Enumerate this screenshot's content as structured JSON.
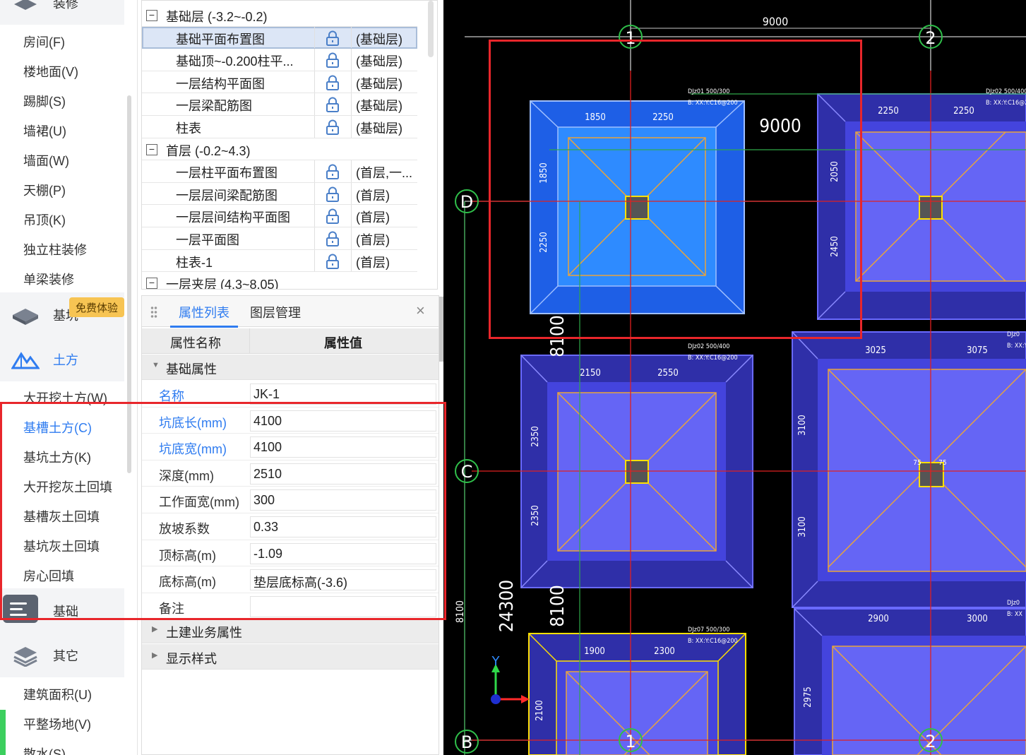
{
  "left_nav": {
    "top_partial": "装修",
    "items_a": [
      "房间(F)",
      "楼地面(V)",
      "踢脚(S)",
      "墙裙(U)",
      "墙面(W)",
      "天棚(P)",
      "吊顶(K)",
      "独立柱装修",
      "单梁装修"
    ],
    "cat_foundation_partial": "基坑",
    "free_badge": "免费体验",
    "cat_earthwork": "土方",
    "items_b": [
      "大开挖土方(W)",
      "基槽土方(C)",
      "基坑土方(K)",
      "大开挖灰土回填",
      "基槽灰土回填",
      "基坑灰土回填",
      "房心回填"
    ],
    "cat_base": "基础",
    "cat_other": "其它",
    "items_c": [
      "建筑面积(U)",
      "平整场地(V)",
      "散水(S)"
    ]
  },
  "tree": {
    "groups": [
      {
        "label": "基础层 (-3.2~-0.2)",
        "rows": [
          {
            "name": "基础平面布置图",
            "layer": "(基础层)"
          },
          {
            "name": "基础顶~-0.200柱平...",
            "layer": "(基础层)"
          },
          {
            "name": "一层结构平面图",
            "layer": "(基础层)"
          },
          {
            "name": "一层梁配筋图",
            "layer": "(基础层)"
          },
          {
            "name": "柱表",
            "layer": "(基础层)"
          }
        ]
      },
      {
        "label": "首层 (-0.2~4.3)",
        "rows": [
          {
            "name": "一层柱平面布置图",
            "layer": "(首层,一..."
          },
          {
            "name": "一层层间梁配筋图",
            "layer": "(首层)"
          },
          {
            "name": "一层层间结构平面图",
            "layer": "(首层)"
          },
          {
            "name": "一层平面图",
            "layer": "(首层)"
          },
          {
            "name": "柱表-1",
            "layer": "(首层)"
          }
        ]
      },
      {
        "label": "一层夹层 (4.3~8.05)",
        "rows": []
      }
    ],
    "expand_symbol": "−"
  },
  "props": {
    "tab_active": "属性列表",
    "tab_other": "图层管理",
    "col_name": "属性名称",
    "col_value": "属性值",
    "section_base": "基础属性",
    "rows": [
      {
        "k": "名称",
        "v": "JK-1",
        "blue": true
      },
      {
        "k": "坑底长(mm)",
        "v": "4100",
        "blue": true
      },
      {
        "k": "坑底宽(mm)",
        "v": "4100",
        "blue": true
      },
      {
        "k": "深度(mm)",
        "v": "2510",
        "blue": false
      },
      {
        "k": "工作面宽(mm)",
        "v": "300",
        "blue": false
      },
      {
        "k": "放坡系数",
        "v": "0.33",
        "blue": false
      },
      {
        "k": "顶标高(m)",
        "v": "-1.09",
        "blue": false
      },
      {
        "k": "底标高(m)",
        "v": "垫层底标高(-3.6)",
        "blue": false
      },
      {
        "k": "备注",
        "v": "",
        "blue": false
      }
    ],
    "section_civil": "土建业务属性",
    "section_display": "显示样式",
    "close_symbol": "×",
    "collapse_symbol": "<"
  },
  "cad": {
    "top_dim": "9000",
    "big_dim": "9000",
    "axis_labels": {
      "a1": "1",
      "a2": "2",
      "aD": "D",
      "aC": "C",
      "aB": "B"
    },
    "left_dims": {
      "d1": "8100",
      "d2": "8100",
      "d3": "24300",
      "d4": "8100"
    },
    "coord_y": "Y",
    "colors": {
      "canvas": "#000000",
      "pit_outer": "#2f2fa8",
      "pit_mid": "#4444dd",
      "pit_inner": "#6565f5",
      "sel_outer": "#1e5fe6",
      "sel_inner": "#2e8bff",
      "axis": "#e02020",
      "highlight": "#e8262b",
      "yellow": "#ffe000",
      "orange": "#e8a33c"
    },
    "pit1": {
      "t1": "1850",
      "t2": "2250",
      "l1": "1850",
      "l2": "2250",
      "note1": "DJz01 500/300",
      "note2": "B: XX:Y:C16@200"
    },
    "pit2": {
      "t1": "2250",
      "t2": "2250",
      "l1": "2050",
      "l2": "2450",
      "note1": "DJz02 500/400",
      "note2": "B: XX:Y:C16@2"
    },
    "pit3": {
      "t1": "2150",
      "t2": "2550",
      "l1": "2350",
      "l2": "2350",
      "note1": "DJz02 500/400",
      "note2": "B: XX:Y:C16@200"
    },
    "pit4": {
      "t1": "3025",
      "t2": "3075",
      "l1": "3100",
      "l2": "3100",
      "note1": "DJz0",
      "note2": "B: XX:Y",
      "small1": "75",
      "small2": "75"
    },
    "pit5": {
      "t1": "1900",
      "t2": "2300",
      "l1": "2100",
      "note1": "DJz07 500/300",
      "note2": "B: XX:Y:C16@200"
    },
    "pit6": {
      "t1": "2900",
      "t2": "3000",
      "l1": "2975",
      "note1": "DJz0",
      "note2": "B: XX"
    }
  }
}
